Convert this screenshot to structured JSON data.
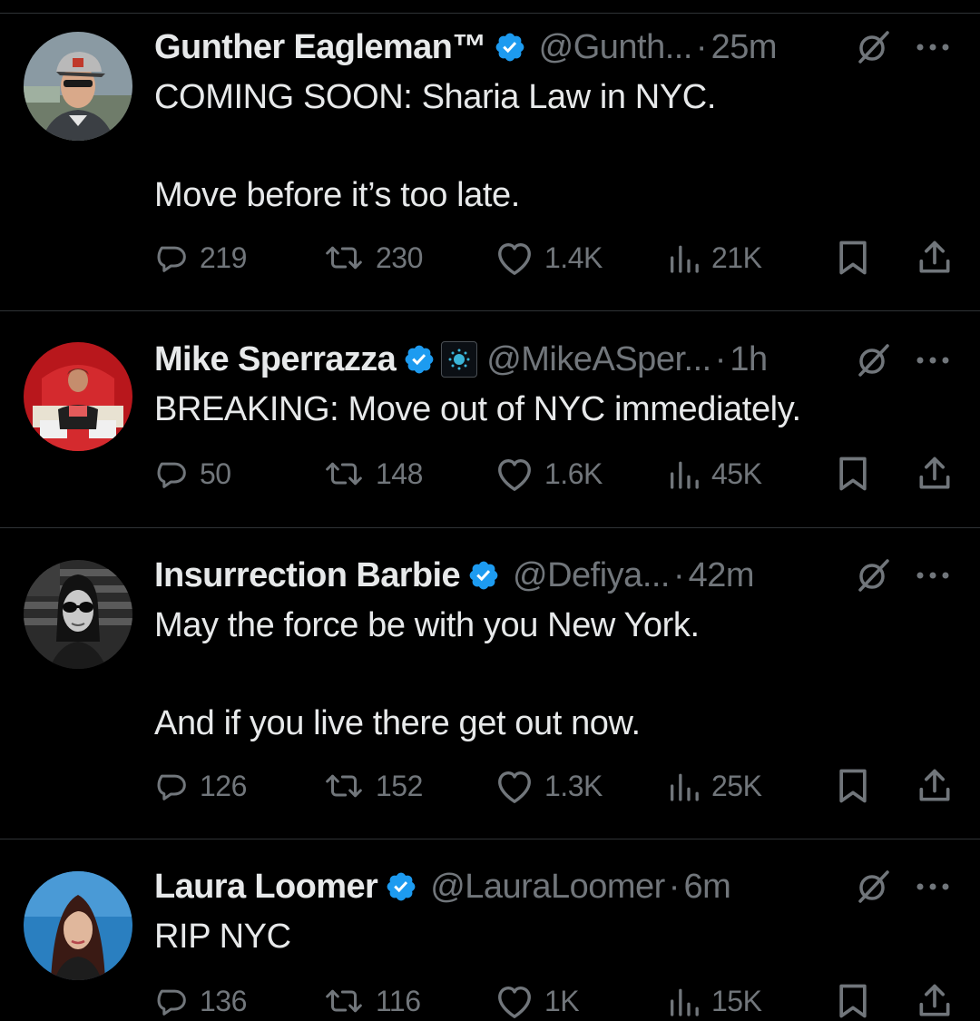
{
  "colors": {
    "background": "#000000",
    "text": "#e7e9ea",
    "muted": "#71767b",
    "divider": "#2f3336",
    "verified": "#1d9bf0"
  },
  "tweets": [
    {
      "name": "Gunther Eagleman™",
      "handle": "@Gunth...",
      "time": "25m",
      "text": "COMING SOON: Sharia Law in NYC.\n\nMove before it’s too late.",
      "replies": "219",
      "reposts": "230",
      "likes": "1.4K",
      "views": "21K"
    },
    {
      "name": "Mike Sperrazza",
      "handle": "@MikeASper...",
      "time": "1h",
      "text": "BREAKING: Move out of NYC immediately.",
      "replies": "50",
      "reposts": "148",
      "likes": "1.6K",
      "views": "45K"
    },
    {
      "name": "Insurrection Barbie",
      "handle": "@Defiya...",
      "time": "42m",
      "text": "May the force be with you New York.\n\nAnd if you live there get out now.",
      "replies": "126",
      "reposts": "152",
      "likes": "1.3K",
      "views": "25K"
    },
    {
      "name": "Laura Loomer",
      "handle": "@LauraLoomer",
      "time": "6m",
      "text": "RIP NYC",
      "replies": "136",
      "reposts": "116",
      "likes": "1K",
      "views": "15K"
    }
  ]
}
